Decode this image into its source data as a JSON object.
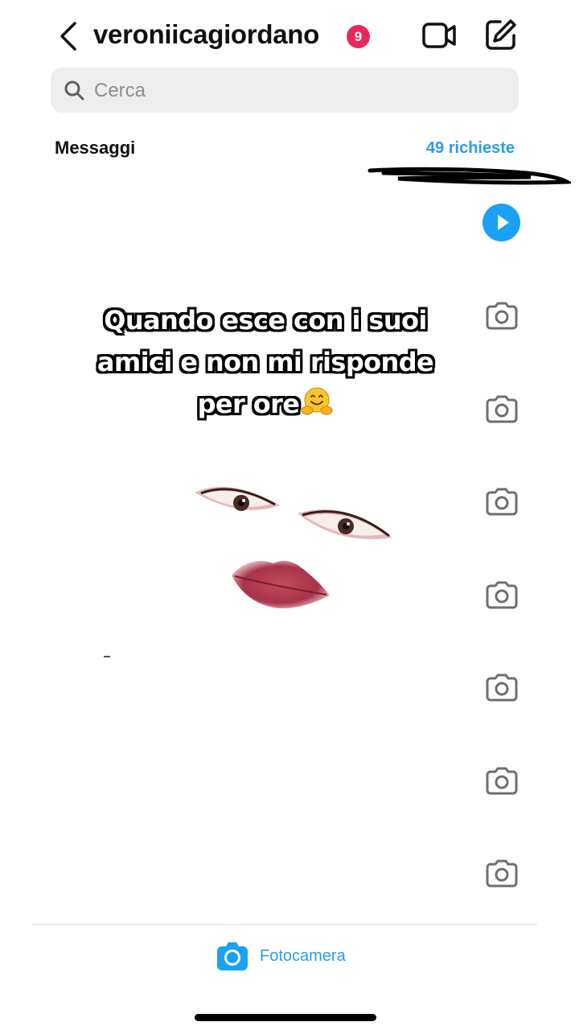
{
  "header": {
    "username": "veroniicagiordano",
    "notification_count": "9"
  },
  "search": {
    "placeholder": "Cerca"
  },
  "messages": {
    "section_title": "Messaggi",
    "requests_label": "49 richieste"
  },
  "overlay": {
    "caption_lines": [
      "Quando esce con i suoi",
      "amici e non mi risponde",
      "per ore"
    ],
    "emoji": "hugging-face-icon"
  },
  "row_icons": [
    "play-icon",
    "camera-icon",
    "camera-icon",
    "camera-icon",
    "camera-icon",
    "camera-icon",
    "camera-icon",
    "camera-icon"
  ],
  "bottom_bar": {
    "camera_label": "Fotocamera"
  },
  "colors": {
    "accent": "#2a9de8",
    "badge": "#e8285a",
    "play_button": "#1aa1f5",
    "search_bg": "#eeeeef"
  }
}
